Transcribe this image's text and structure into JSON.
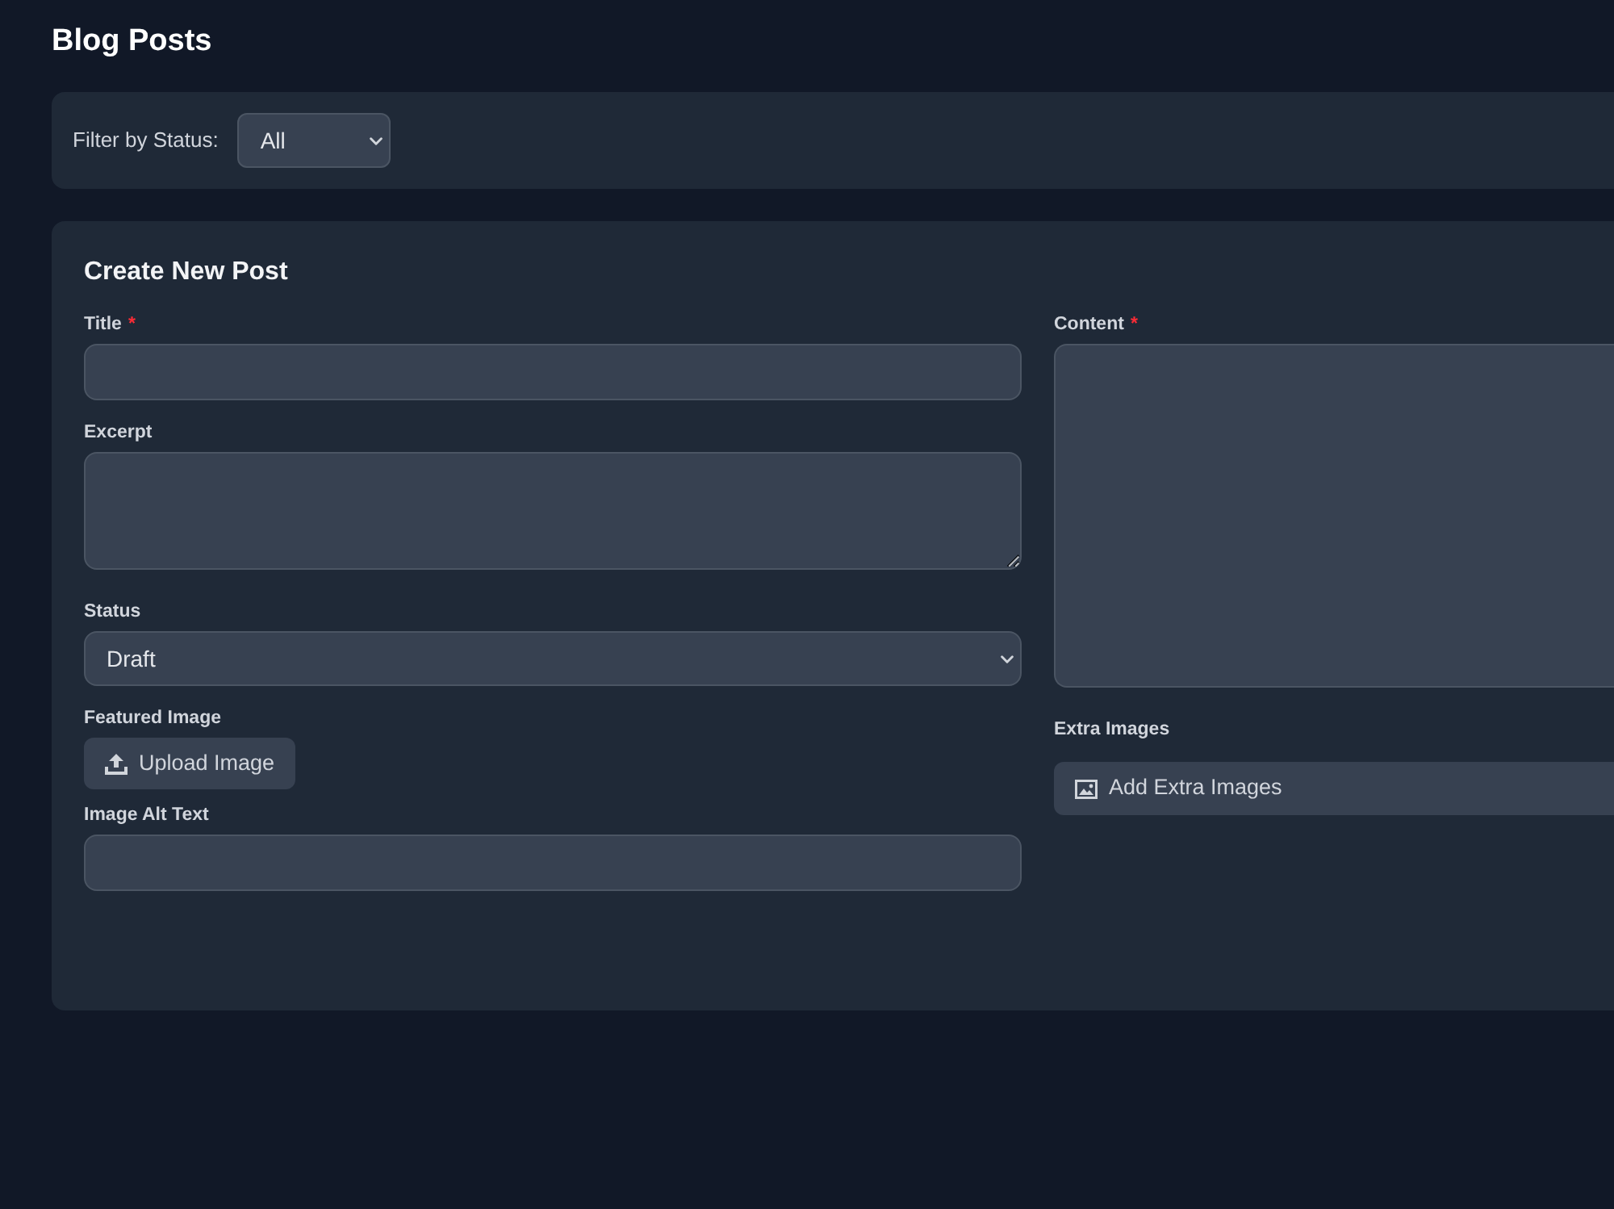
{
  "page": {
    "title": "Blog Posts"
  },
  "filter": {
    "label": "Filter by Status:",
    "value": "All"
  },
  "form": {
    "title": "Create New Post",
    "left_fields": [
      {
        "kind": "input",
        "label": "Title",
        "required_mark": "*"
      },
      {
        "kind": "textarea",
        "label": "Excerpt"
      },
      {
        "kind": "select",
        "label": "Status",
        "value": "Draft"
      },
      {
        "kind": "upload",
        "label": "Featured Image",
        "button": "Upload Image"
      },
      {
        "kind": "input",
        "label": "Image Alt Text"
      }
    ],
    "right_fields": [
      {
        "kind": "textarea",
        "label": "Content",
        "required_mark": "*"
      },
      {
        "kind": "add_images",
        "label": "Extra Images",
        "button": "Add Extra Images"
      }
    ]
  }
}
